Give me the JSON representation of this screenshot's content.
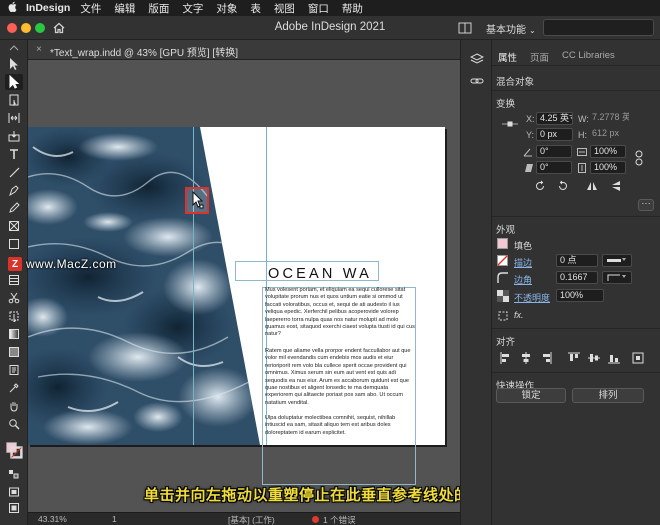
{
  "menubar": {
    "apple": "",
    "app": "InDesign",
    "items": [
      "文件",
      "编辑",
      "版面",
      "文字",
      "对象",
      "表",
      "视图",
      "窗口",
      "帮助"
    ]
  },
  "appbar": {
    "title": "Adobe InDesign 2021",
    "workspace": "基本功能",
    "workspace_chevron": "⌄"
  },
  "document_tab": {
    "close": "×",
    "label": "*Text_wrap.indd @ 43% [GPU 预览] [转换]"
  },
  "document": {
    "heading": "OCEAN WA",
    "paragraphs": [
      "Mus volesent poriam, et eliquiam ea sequi cullorese sitat volupitate prorum nus et quos untium eatie si ommod ut faccati voloratibus, occus et, sequi de ati audesto il ius veliqua epedic. Xerferchil pelibus acoperovide volorep laepererro torra nulpa quas nos natur molupti ad molo quamus eost, sitaquod exerchi ciaest volupta tiusti id qui cus natur?",
      "Ratem que aliame vella prorpor endent faccullabor aut que volor mil evendandis cum endebis mos audis et eiur rerioriporit rem volo bla cullece sperit occae provident qui omnimus. Ximus serum sin eum aut vent est quis adi sequodis ea nus eiur. Arum es accaborum quidunt est que quae nostibus et aligent lonsedic te ma demquata experiorem qui alitaecte poriast pos sam abo. Ut occum natatium vendital.",
      "Ulpa doluptatur molectibea comnihit, sequist, nihillab intiuscid ea sam, sitasit aliquo tem est aribus doles doloreptatem id earum explicitet."
    ]
  },
  "watermark": {
    "badge": "Z",
    "text": "www.MacZ.com"
  },
  "subtitle": "单击并向左拖动以重塑停止在此垂直参考线处的图像帧",
  "statusbar": {
    "zoom": "43.31%",
    "page": "1",
    "style": "[基本] (工作)",
    "errors": "1 个错误"
  },
  "panel": {
    "tabs": [
      "属性",
      "页面",
      "CC Libraries"
    ],
    "mixed_objects": "混合对象",
    "transform": {
      "title": "变换",
      "x_label": "X:",
      "x_value": "4.25 英寸",
      "w_label": "W:",
      "w_value": "7.2778 英",
      "y_label": "Y:",
      "y_value": "0 px",
      "h_label": "H:",
      "h_value": "612 px",
      "rotate_value": "0°",
      "scale_x_value": "100%",
      "shear_value": "0°",
      "scale_y_value": "100%"
    },
    "appearance": {
      "title": "外观",
      "fill_label": "填色",
      "stroke_label": "描边",
      "stroke_weight": "0 点",
      "corner_label": "边角",
      "corner_value": "0.1667",
      "opacity_label": "不透明度",
      "opacity_value": "100%",
      "fx_label": "fx."
    },
    "align": {
      "title": "对齐"
    },
    "quick_actions": {
      "title": "快速操作",
      "lock_label": "锁定",
      "arrange_label": "排列"
    }
  },
  "colors": {
    "fill_swatch": "#f2c9d2",
    "stroke_swatch": "#ffffff",
    "highlight": "#e0302a",
    "subtitle": "#f0dc3a"
  }
}
